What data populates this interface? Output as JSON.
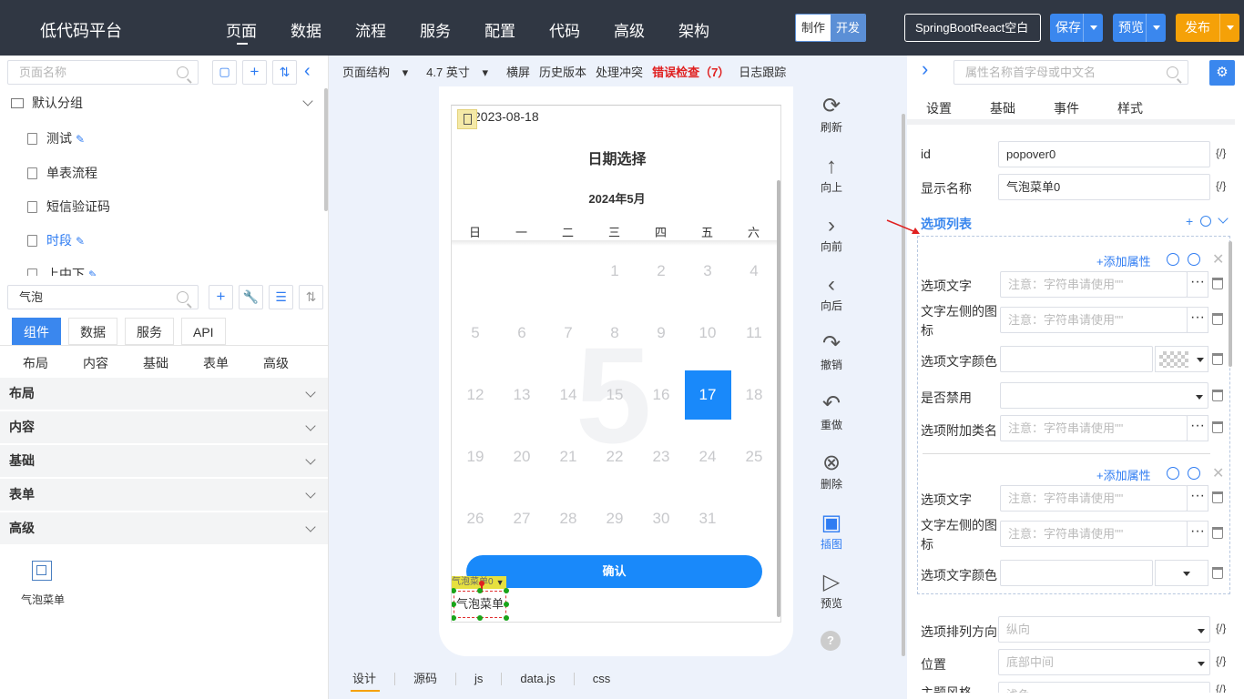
{
  "header": {
    "logo": "低代码平台",
    "nav": [
      "页面",
      "数据",
      "流程",
      "服务",
      "配置",
      "代码",
      "高级",
      "架构"
    ],
    "mode": [
      "制作",
      "开发"
    ],
    "project": "SpringBootReact空白",
    "save": "保存",
    "preview": "预览",
    "publish": "发布",
    "colors": {
      "bar": "#303743",
      "save": "#3a87ee",
      "preview": "#3a87ee",
      "publish": "#f5a108"
    }
  },
  "left": {
    "page_search_placeholder": "页面名称",
    "group": "默认分组",
    "pages": [
      "测试",
      "单表流程",
      "短信验证码",
      "时段",
      "上中下"
    ],
    "component_search": "气泡",
    "tabs": [
      "组件",
      "数据",
      "服务",
      "API"
    ],
    "subtabs": [
      "布局",
      "内容",
      "基础",
      "表单",
      "高级"
    ],
    "sections": [
      "布局",
      "内容",
      "基础",
      "表单",
      "高级"
    ],
    "component": "气泡菜单"
  },
  "toolbar": {
    "structure": "页面结构",
    "size": "4.7 英寸",
    "landscape": "横屏",
    "history": "历史版本",
    "conflict": "处理冲突",
    "errors": "错误检查（7）",
    "log": "日志跟踪"
  },
  "phone": {
    "date_value": "2023-08-18",
    "title": "日期选择",
    "month": "2024年5月",
    "weekdays": [
      "日",
      "一",
      "二",
      "三",
      "四",
      "五",
      "六"
    ],
    "month_bg": "5",
    "days": [
      "1",
      "2",
      "3",
      "4",
      "5",
      "6",
      "7",
      "8",
      "9",
      "10",
      "11",
      "12",
      "13",
      "14",
      "15",
      "16",
      "17",
      "18",
      "19",
      "20",
      "21",
      "22",
      "23",
      "24",
      "25",
      "26",
      "27",
      "28",
      "29",
      "30",
      "31"
    ],
    "selected_day": "17",
    "confirm": "确认",
    "popover_tag": "气泡菜单0",
    "popover_text": "气泡菜单"
  },
  "tools": [
    "刷新",
    "向上",
    "向前",
    "向后",
    "撤销",
    "重做",
    "删除",
    "插图",
    "预览"
  ],
  "bottom_tabs": [
    "设计",
    "源码",
    "js",
    "data.js",
    "css"
  ],
  "right": {
    "search_placeholder": "属性名称首字母或中文名",
    "tabs": [
      "设置",
      "基础",
      "事件",
      "样式"
    ],
    "id_label": "id",
    "id_value": "popover0",
    "name_label": "显示名称",
    "name_value": "气泡菜单0",
    "code": "{/}",
    "options_title": "选项列表",
    "add_attr": "+添加属性",
    "option_text": "选项文字",
    "left_icon": "文字左侧的图标",
    "text_color": "选项文字颜色",
    "disabled": "是否禁用",
    "class_name": "选项附加类名",
    "placeholder": "注意：字符串请使用\"\"",
    "direction_label": "选项排列方向",
    "direction_value": "纵向",
    "position_label": "位置",
    "position_value": "底部中间",
    "theme_label": "主题风格",
    "theme_value": "浅色"
  }
}
